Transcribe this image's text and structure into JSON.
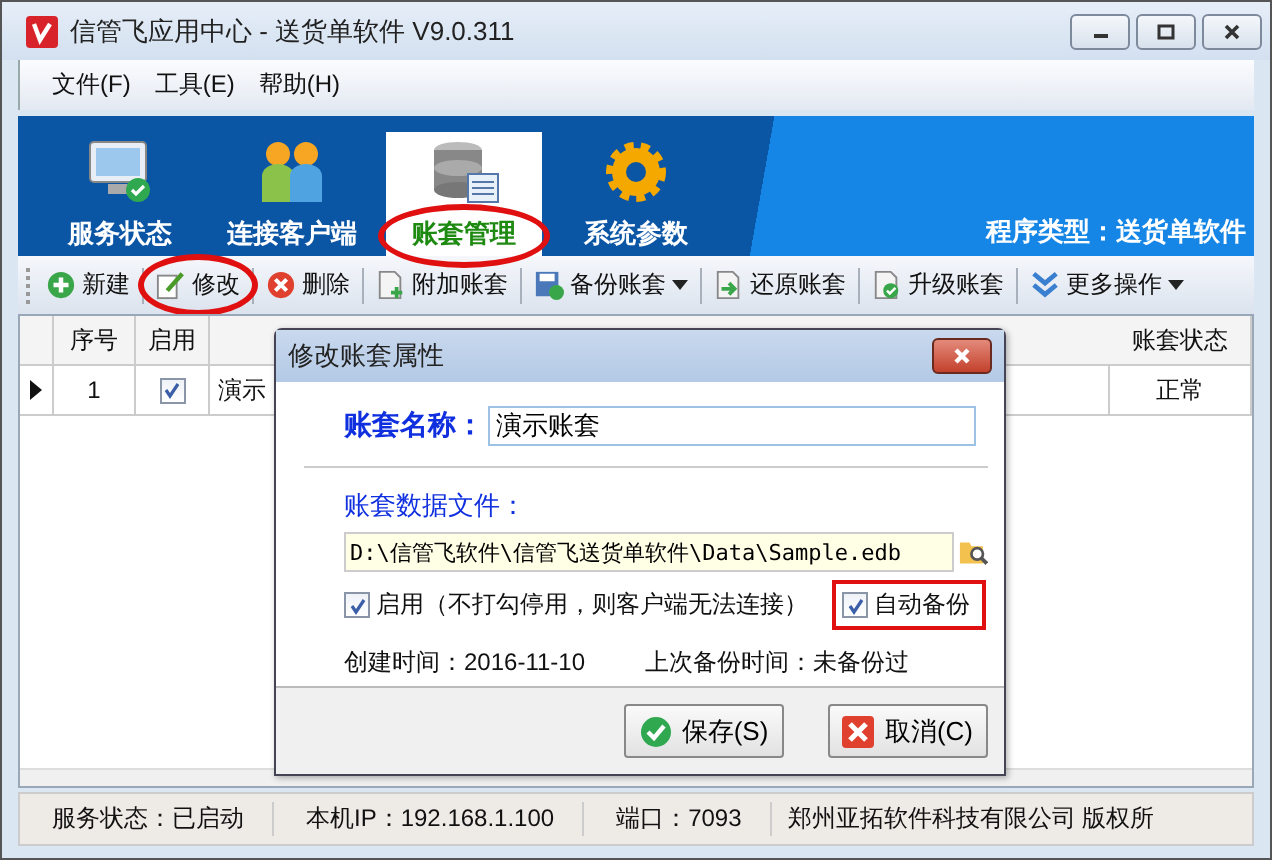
{
  "window": {
    "title": "信管飞应用中心 - 送货单软件 V9.0.311"
  },
  "menu": [
    "文件(F)",
    "工具(E)",
    "帮助(H)"
  ],
  "nav_tabs": [
    {
      "label": "服务状态",
      "kind": "monitor",
      "selected": false,
      "highlighted": false
    },
    {
      "label": "连接客户端",
      "kind": "users",
      "selected": false,
      "highlighted": false
    },
    {
      "label": "账套管理",
      "kind": "database",
      "selected": true,
      "highlighted": true
    },
    {
      "label": "系统参数",
      "kind": "gear",
      "selected": false,
      "highlighted": false
    }
  ],
  "program_type": "程序类型：送货单软件",
  "toolbar": [
    {
      "label": "新建",
      "kind": "new",
      "dropdown": false,
      "highlighted": false
    },
    {
      "label": "修改",
      "kind": "edit",
      "dropdown": false,
      "highlighted": true
    },
    {
      "label": "删除",
      "kind": "delete",
      "dropdown": false,
      "highlighted": false
    },
    {
      "label": "附加账套",
      "kind": "attach",
      "dropdown": false,
      "highlighted": false
    },
    {
      "label": "备份账套",
      "kind": "backup",
      "dropdown": true,
      "highlighted": false
    },
    {
      "label": "还原账套",
      "kind": "restore",
      "dropdown": false,
      "highlighted": false
    },
    {
      "label": "升级账套",
      "kind": "upgrade",
      "dropdown": false,
      "highlighted": false
    },
    {
      "label": "更多操作",
      "kind": "more",
      "dropdown": true,
      "highlighted": false
    }
  ],
  "table": {
    "columns": [
      {
        "label": "序号"
      },
      {
        "label": "启用"
      },
      {
        "label": "账套状态"
      }
    ],
    "rows": [
      {
        "index": "1",
        "enabled": true,
        "name": "演示",
        "status": "正常",
        "selected": true
      }
    ]
  },
  "dialog": {
    "title": "修改账套属性",
    "name_label": "账套名称：",
    "name_value": "演示账套",
    "file_label": "账套数据文件：",
    "file_value": "D:\\信管飞软件\\信管飞送货单软件\\Data\\Sample.edb",
    "enable": {
      "label": "启用（不打勾停用，则客户端无法连接）",
      "checked": true,
      "highlighted": false
    },
    "auto_backup": {
      "label": "自动备份",
      "checked": true,
      "highlighted": true
    },
    "created": "创建时间：2016-11-10",
    "last_backup": "上次备份时间：未备份过",
    "buttons": [
      {
        "label": "保存(S)",
        "kind": "ok"
      },
      {
        "label": "取消(C)",
        "kind": "cancel"
      }
    ]
  },
  "status_bar": [
    "服务状态：已启动",
    "本机IP：192.168.1.100",
    "端口：7093",
    "郑州亚拓软件科技有限公司 版权所"
  ]
}
